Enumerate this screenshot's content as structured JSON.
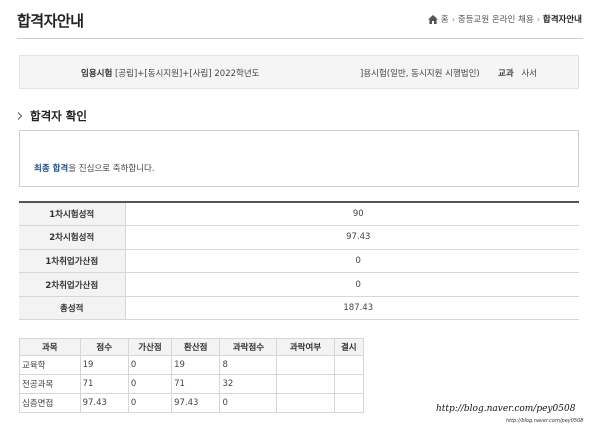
{
  "header": {
    "title": "합격자안내",
    "breadcrumb": {
      "home_icon": "home-icon",
      "home": "홈",
      "level1": "중등교원 온라인 채용",
      "current": "합격자안내"
    }
  },
  "exam_info": {
    "label": "임용시험",
    "prefix": "[공립]+[동시지원]+[사립] 2022학년도",
    "suffix": "]용시험(일반, 동시지원 시행법인)",
    "subject_label": "교과",
    "subject_value": "사서"
  },
  "result": {
    "section_title": "합격자 확인",
    "highlight": "최종 합격",
    "message": "을 진심으로 축하합니다.",
    "highlight_color": "#1f4f8b"
  },
  "scores": [
    {
      "label": "1차시험성적",
      "value": "90"
    },
    {
      "label": "2차시험성적",
      "value": "97.43"
    },
    {
      "label": "1차취업가산점",
      "value": "0"
    },
    {
      "label": "2차취업가산점",
      "value": "0"
    },
    {
      "label": "총성적",
      "value": "187.43"
    }
  ],
  "detail": {
    "headers": [
      "과목",
      "점수",
      "가산점",
      "환산점",
      "과락점수",
      "과락여부",
      "결시"
    ],
    "rows": [
      [
        "교육학",
        "19",
        "0",
        "19",
        "8",
        "",
        ""
      ],
      [
        "전공과목",
        "71",
        "0",
        "71",
        "32",
        "",
        ""
      ],
      [
        "심층면접",
        "97.43",
        "0",
        "97.43",
        "0",
        "",
        ""
      ]
    ]
  },
  "watermark": {
    "main": "http://blog.naver.com/pey0508",
    "sub": "http://blog.naver.com/pey0508"
  }
}
